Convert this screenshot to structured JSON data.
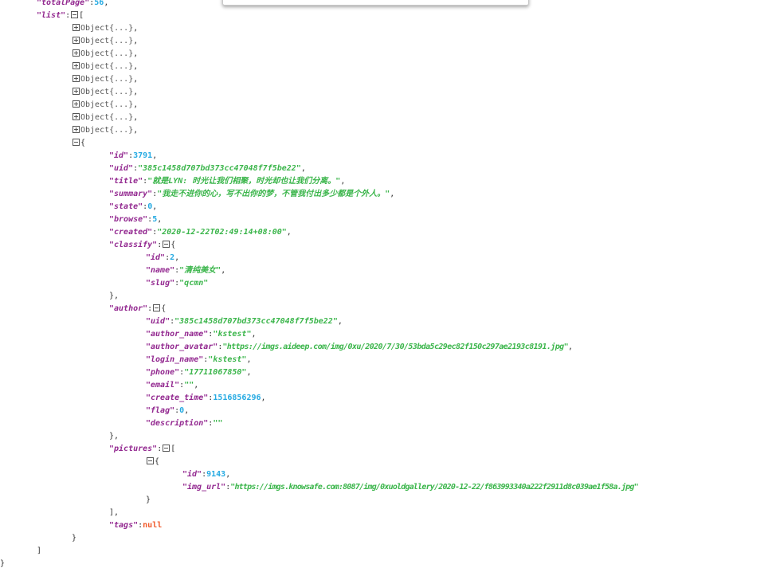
{
  "totalPage": {
    "key": "\"totalPage\"",
    "value": "56"
  },
  "list": {
    "key": "\"list\"",
    "collapsed_label": "Object{...}",
    "collapsed_count": 9
  },
  "item": {
    "id": {
      "key": "\"id\"",
      "value": "3791"
    },
    "uid": {
      "key": "\"uid\"",
      "value": "\"385c1458d707bd373cc47048f7f5be22\""
    },
    "title": {
      "key": "\"title\"",
      "value": "\"就是LYN: 时光让我们相聚，时光却也让我们分离。\""
    },
    "summary": {
      "key": "\"summary\"",
      "value": "\"我走不进你的心，写不出你的梦，不管我付出多少都是个外人。\""
    },
    "state": {
      "key": "\"state\"",
      "value": "0"
    },
    "browse": {
      "key": "\"browse\"",
      "value": "5"
    },
    "created": {
      "key": "\"created\"",
      "value": "\"2020-12-22T02:49:14+08:00\""
    },
    "classify": {
      "key": "\"classify\"",
      "id": {
        "key": "\"id\"",
        "value": "2"
      },
      "name": {
        "key": "\"name\"",
        "value": "\"清纯美女\""
      },
      "slug": {
        "key": "\"slug\"",
        "value": "\"qcmn\""
      }
    },
    "author": {
      "key": "\"author\"",
      "uid": {
        "key": "\"uid\"",
        "value": "\"385c1458d707bd373cc47048f7f5be22\""
      },
      "author_name": {
        "key": "\"author_name\"",
        "value": "\"kstest\""
      },
      "author_avatar": {
        "key": "\"author_avatar\"",
        "value": "\"https://imgs.aideep.com/img/0xu/2020/7/30/53bda5c29ec82f150c297ae2193c8191.jpg\""
      },
      "login_name": {
        "key": "\"login_name\"",
        "value": "\"kstest\""
      },
      "phone": {
        "key": "\"phone\"",
        "value": "\"17711067850\""
      },
      "email": {
        "key": "\"email\"",
        "value": "\"\""
      },
      "create_time": {
        "key": "\"create_time\"",
        "value": "1516856296"
      },
      "flag": {
        "key": "\"flag\"",
        "value": "0"
      },
      "description": {
        "key": "\"description\"",
        "value": "\"\""
      }
    },
    "pictures": {
      "key": "\"pictures\"",
      "id": {
        "key": "\"id\"",
        "value": "9143"
      },
      "img_url": {
        "key": "\"img_url\"",
        "value": "\"https://imgs.knowsafe.com:8087/img/0xuoldgallery/2020-12-22/f863993340a222f2911d8c039ae1f58a.jpg\""
      }
    },
    "tags": {
      "key": "\"tags\"",
      "value": "null"
    }
  },
  "punct": {
    "colon": ":",
    "comma": ",",
    "open_brace": "{",
    "close_brace": "}",
    "close_brace_comma": "},",
    "open_bracket": "[",
    "close_bracket": "]",
    "close_bracket_comma": "],"
  },
  "icons": {
    "expand": "plus-box-icon",
    "collapse": "minus-box-icon"
  }
}
